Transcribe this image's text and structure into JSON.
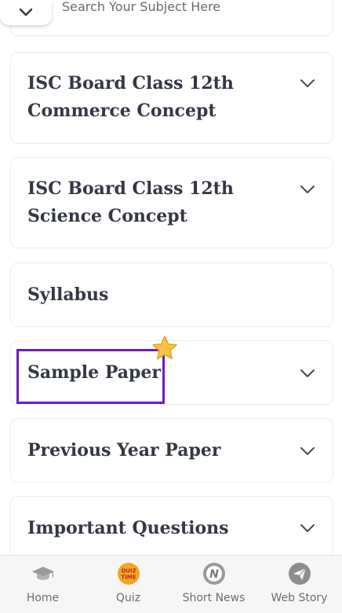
{
  "search": {
    "placeholder": "Search Your Subject Here"
  },
  "accordion": [
    {
      "title": "ISC Board Class 12th Commerce Concept"
    },
    {
      "title": "ISC Board Class 12th Science Concept"
    },
    {
      "title": "Syllabus"
    },
    {
      "title": "Sample Paper"
    },
    {
      "title": "Previous Year Paper"
    },
    {
      "title": "Important Questions"
    }
  ],
  "bottom_nav": {
    "items": [
      {
        "label": "Home",
        "icon": "graduation-cap-icon"
      },
      {
        "label": "Quiz",
        "icon": "quiz-time-icon",
        "badge_text": "QUIZ TIME"
      },
      {
        "label": "Short News",
        "icon": "news-n-icon",
        "badge_text": "N"
      },
      {
        "label": "Web Story",
        "icon": "paper-plane-icon"
      }
    ]
  },
  "colors": {
    "highlight": "#6a1bc4",
    "title": "#333845",
    "star": "#f6c343",
    "quiz_badge": "#f4a523"
  }
}
